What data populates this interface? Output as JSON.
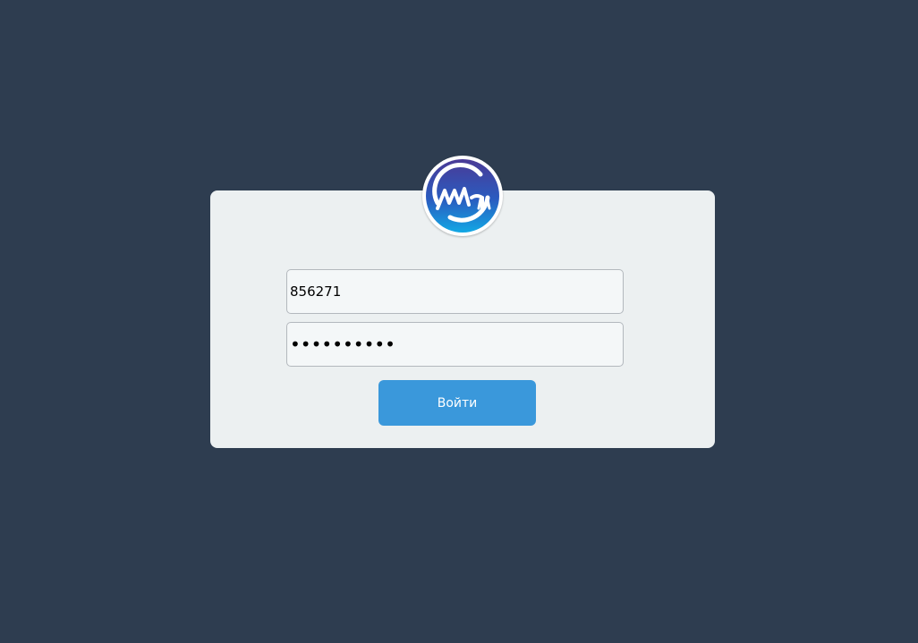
{
  "logo": {
    "icon": "mm-logo-icon"
  },
  "login_form": {
    "login_value": "856271",
    "password_value": "••••••••••",
    "submit_label": "Войти"
  },
  "colors": {
    "background": "#2e3d50",
    "card": "#ecf0f1",
    "button": "#3a98db",
    "button_text": "#ffffff",
    "logo_gradient_top": "#4a3a96",
    "logo_gradient_bottom": "#12a8e4"
  }
}
